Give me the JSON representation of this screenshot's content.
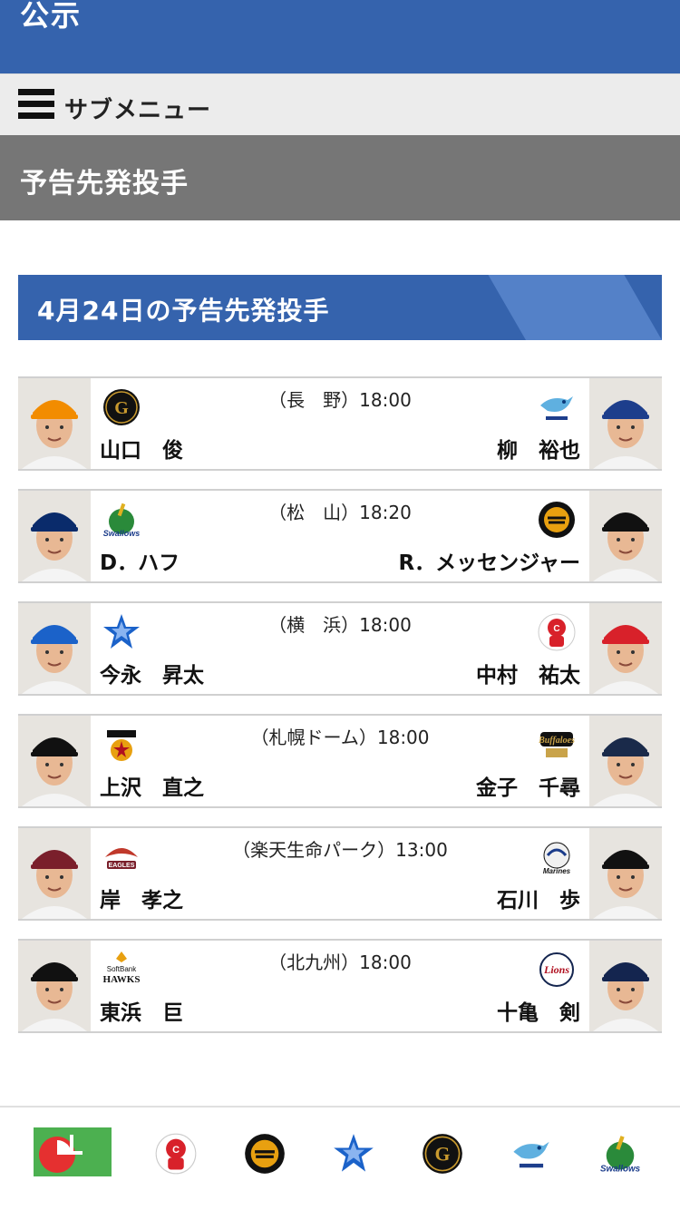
{
  "header": {
    "title": "公示"
  },
  "submenu": {
    "label": "サブメニュー"
  },
  "section": {
    "title": "予告先発投手"
  },
  "date_banner": {
    "title": "4月24日の予告先発投手"
  },
  "games": [
    {
      "venue": "（長　野）18:00",
      "home_pitcher": "山口　俊",
      "away_pitcher": "柳　裕也",
      "home_team_icon": "giants-logo-icon",
      "away_team_icon": "dragons-logo-icon",
      "colors": {
        "home": "#f28c00",
        "away": "#1d3e8c"
      }
    },
    {
      "venue": "（松　山）18:20",
      "home_pitcher": "D．ハフ",
      "away_pitcher": "R．メッセンジャー",
      "home_team_icon": "swallows-logo-icon",
      "away_team_icon": "tigers-logo-icon",
      "colors": {
        "home": "#0a2b6b",
        "away": "#111111"
      }
    },
    {
      "venue": "（横　浜）18:00",
      "home_pitcher": "今永　昇太",
      "away_pitcher": "中村　祐太",
      "home_team_icon": "baystars-logo-icon",
      "away_team_icon": "carp-logo-icon",
      "colors": {
        "home": "#1b62c9",
        "away": "#d8212a"
      }
    },
    {
      "venue": "（札幌ドーム）18:00",
      "home_pitcher": "上沢　直之",
      "away_pitcher": "金子　千尋",
      "home_team_icon": "fighters-logo-icon",
      "away_team_icon": "buffaloes-logo-icon",
      "colors": {
        "home": "#111111",
        "away": "#1a2a4a"
      }
    },
    {
      "venue": "（楽天生命パーク）13:00",
      "home_pitcher": "岸　孝之",
      "away_pitcher": "石川　歩",
      "home_team_icon": "eagles-logo-icon",
      "away_team_icon": "marines-logo-icon",
      "colors": {
        "home": "#7a1f2b",
        "away": "#111111"
      }
    },
    {
      "venue": "（北九州）18:00",
      "home_pitcher": "東浜　巨",
      "away_pitcher": "十亀　剣",
      "home_team_icon": "hawks-logo-icon",
      "away_team_icon": "lions-logo-icon",
      "colors": {
        "home": "#111111",
        "away": "#14254f"
      }
    }
  ],
  "team_nav": [
    "central-league-icon",
    "carp-logo-icon",
    "tigers-logo-icon",
    "baystars-logo-icon",
    "giants-logo-icon",
    "dragons-logo-icon",
    "swallows-logo-icon"
  ],
  "theme": {
    "primary": "#3563ad",
    "accent": "#5481c8",
    "section_gray": "#767676",
    "submenu_bg": "#ececec"
  }
}
